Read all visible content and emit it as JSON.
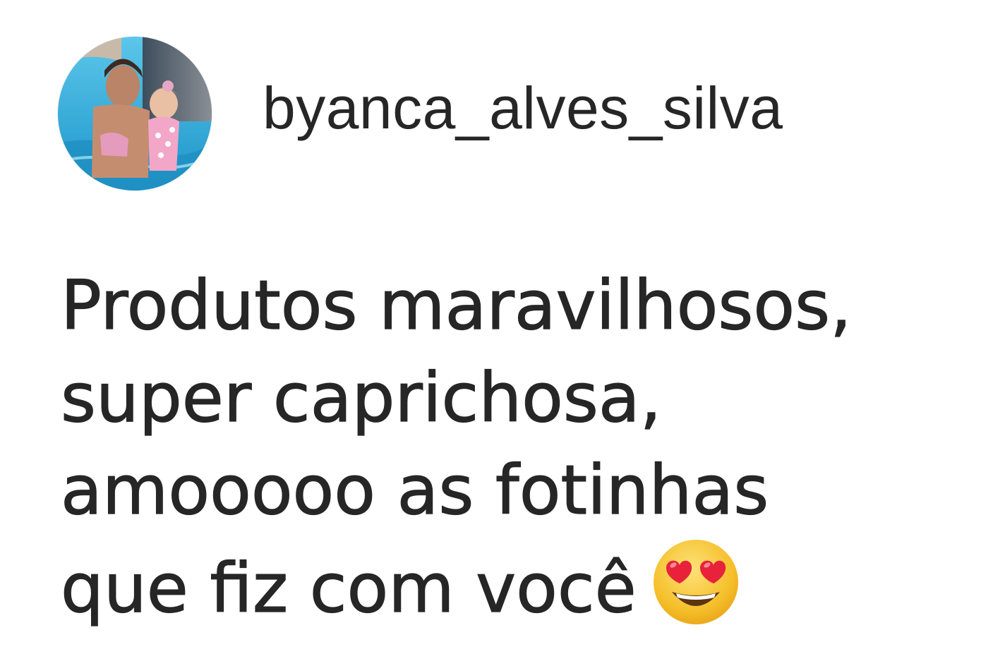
{
  "post": {
    "username": "byanca_alves_silva",
    "avatar_icon": "profile-photo",
    "comment_lines": [
      "Produtos maravilhosos,",
      "super caprichosa,",
      "amooooo as fotinhas",
      "que fiz com você"
    ],
    "emoji": "heart-eyes-emoji"
  },
  "colors": {
    "text": "#262626",
    "background": "#ffffff",
    "pool_blue": "#29a9d8",
    "emoji_face": "#f7c330",
    "emoji_hearts": "#e8223a"
  }
}
